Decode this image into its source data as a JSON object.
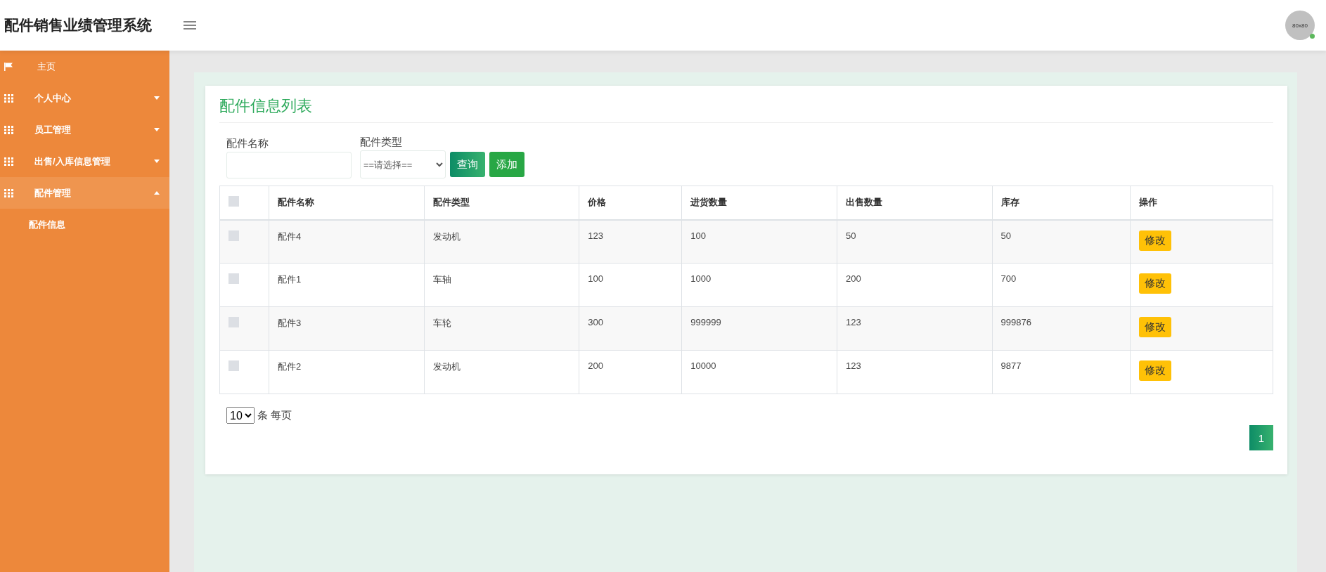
{
  "header": {
    "title": "配件销售业绩管理系统",
    "avatar_text": "80x80",
    "online": true
  },
  "sidebar": {
    "items": [
      {
        "label": "主页",
        "kind": "link",
        "selected": false
      },
      {
        "label": "个人中心",
        "kind": "menu",
        "selected": false,
        "expanded": false
      },
      {
        "label": "员工管理",
        "kind": "menu",
        "selected": false,
        "expanded": false
      },
      {
        "label": "出售/入库信息管理",
        "kind": "menu",
        "selected": false,
        "expanded": false
      },
      {
        "label": "配件管理",
        "kind": "menu",
        "selected": true,
        "expanded": true,
        "children": [
          {
            "label": "配件信息",
            "selected": false
          }
        ]
      }
    ]
  },
  "page": {
    "title": "配件信息列表",
    "filters": {
      "name_label": "配件名称",
      "type_label": "配件类型",
      "type_value": "==请选择==",
      "buttons": [
        {
          "label": "查询",
          "kind": "search"
        },
        {
          "label": "添加",
          "kind": "add"
        }
      ]
    },
    "table": {
      "header_checked": false,
      "columns": [
        "配件名称",
        "配件类型",
        "价格",
        "进货数量",
        "出售数量",
        "库存",
        "操作"
      ],
      "rows": [
        {
          "checked": false,
          "cells": [
            "配件4",
            "发动机",
            "123",
            "100",
            "50",
            "50"
          ],
          "action": "修改"
        },
        {
          "checked": false,
          "cells": [
            "配件1",
            "车轴",
            "100",
            "1000",
            "200",
            "700"
          ],
          "action": "修改"
        },
        {
          "checked": false,
          "cells": [
            "配件3",
            "车轮",
            "300",
            "999999",
            "123",
            "999876"
          ],
          "action": "修改"
        },
        {
          "checked": false,
          "cells": [
            "配件2",
            "发动机",
            "200",
            "10000",
            "123",
            "9877"
          ],
          "action": "修改"
        }
      ]
    },
    "pagination": {
      "page_size": "10",
      "page_size_suffix": "条 每页",
      "pages": [
        {
          "label": "1",
          "selected": true
        }
      ]
    }
  }
}
